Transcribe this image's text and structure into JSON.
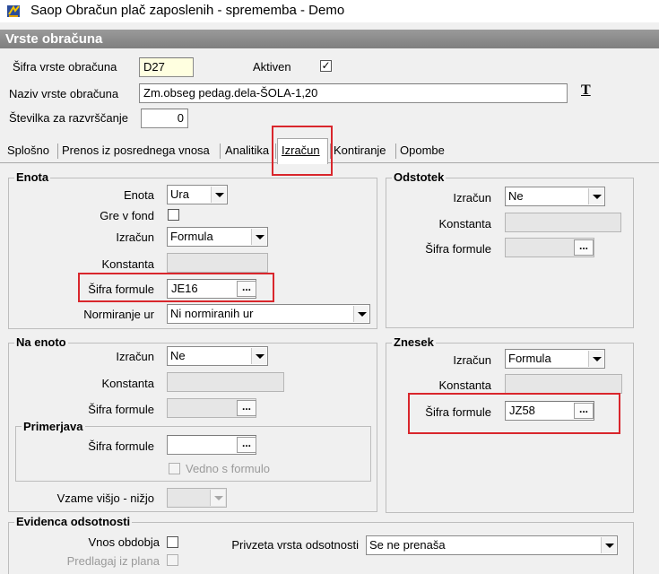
{
  "window": {
    "title": "Saop Obračun plač zaposlenih - sprememba - Demo"
  },
  "header": {
    "title": "Vrste obračuna"
  },
  "top": {
    "sifra_label": "Šifra vrste obračuna",
    "sifra_value": "D27",
    "aktiven_label": "Aktiven",
    "aktiven_checked": true,
    "aktiven_mark": "✓",
    "naziv_label": "Naziv vrste obračuna",
    "naziv_value": "Zm.obseg pedag.dela-ŠOLA-1,20",
    "font_icon_label": "T",
    "stevilka_label": "Številka  za razvrščanje",
    "stevilka_value": "0"
  },
  "tabs": [
    {
      "label": "Splošno",
      "active": false
    },
    {
      "label": "Prenos iz posrednega vnosa",
      "active": false
    },
    {
      "label": "Analitika",
      "active": false
    },
    {
      "label": "Izračun",
      "active": true
    },
    {
      "label": "Kontiranje",
      "active": false
    },
    {
      "label": "Opombe",
      "active": false
    }
  ],
  "enota": {
    "title": "Enota",
    "enota_label": "Enota",
    "enota_value": "Ura",
    "gre_v_fond_label": "Gre v fond",
    "gre_v_fond_checked": false,
    "izracun_label": "Izračun",
    "izracun_value": "Formula",
    "konstanta_label": "Konstanta",
    "sifra_formule_label": "Šifra formule",
    "sifra_formule_value": "JE16",
    "normiranje_label": "Normiranje ur",
    "normiranje_value": "Ni normiranih ur"
  },
  "odstotek": {
    "title": "Odstotek",
    "izracun_label": "Izračun",
    "izracun_value": "Ne",
    "konstanta_label": "Konstanta",
    "sifra_formule_label": "Šifra formule"
  },
  "na_enoto": {
    "title": "Na enoto",
    "izracun_label": "Izračun",
    "izracun_value": "Ne",
    "konstanta_label": "Konstanta",
    "sifra_formule_label": "Šifra formule",
    "primerjava_title": "Primerjava",
    "primerjava_sifra_label": "Šifra formule",
    "vedno_label": "Vedno s formulo",
    "vzame_label": "Vzame višjo - nižjo"
  },
  "znesek": {
    "title": "Znesek",
    "izracun_label": "Izračun",
    "izracun_value": "Formula",
    "konstanta_label": "Konstanta",
    "sifra_formule_label": "Šifra formule",
    "sifra_formule_value": "JZ58"
  },
  "evidenca": {
    "title": "Evidenca odsotnosti",
    "vnos_label": "Vnos obdobja",
    "predlagaj_label": "Predlagaj iz plana",
    "privzeta_label": "Privzeta vrsta odsotnosti",
    "privzeta_value": "Se ne prenaša"
  },
  "ellipsis": "...",
  "colors": {
    "highlight": "#d9262c",
    "header_bg": "#8c8c8c",
    "required_field": "#ffffe0"
  }
}
